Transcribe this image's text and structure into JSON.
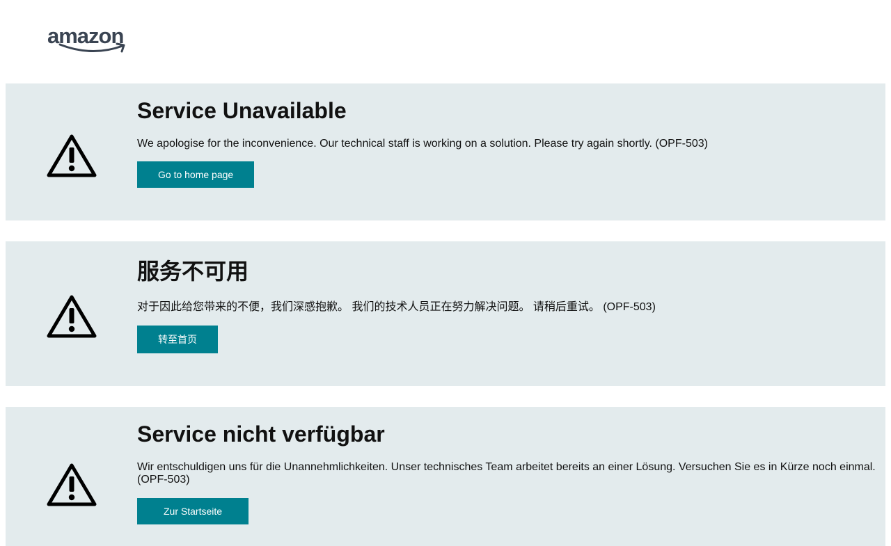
{
  "header": {
    "logo_text": "amazon"
  },
  "panels": [
    {
      "icon": "warning-icon",
      "title": "Service Unavailable",
      "message": "We apologise for the inconvenience. Our technical staff is working on a solution. Please try again shortly. (OPF-503)",
      "button_label": "Go to home page"
    },
    {
      "icon": "warning-icon",
      "title": "服务不可用",
      "message": "对于因此给您带来的不便，我们深感抱歉。 我们的技术人员正在努力解决问题。 请稍后重试。 (OPF-503)",
      "button_label": "转至首页"
    },
    {
      "icon": "warning-icon",
      "title": "Service nicht verfügbar",
      "message": "Wir entschuldigen uns für die Unannehmlichkeiten. Unser technisches Team arbeitet bereits an einer Lösung. Versuchen Sie es in Kürze noch einmal. (OPF-503)",
      "button_label": "Zur Startseite"
    }
  ],
  "colors": {
    "panel_background": "#e3ebed",
    "button_background": "#00808f",
    "button_text": "#ffffff",
    "logo": "#3a4452"
  }
}
